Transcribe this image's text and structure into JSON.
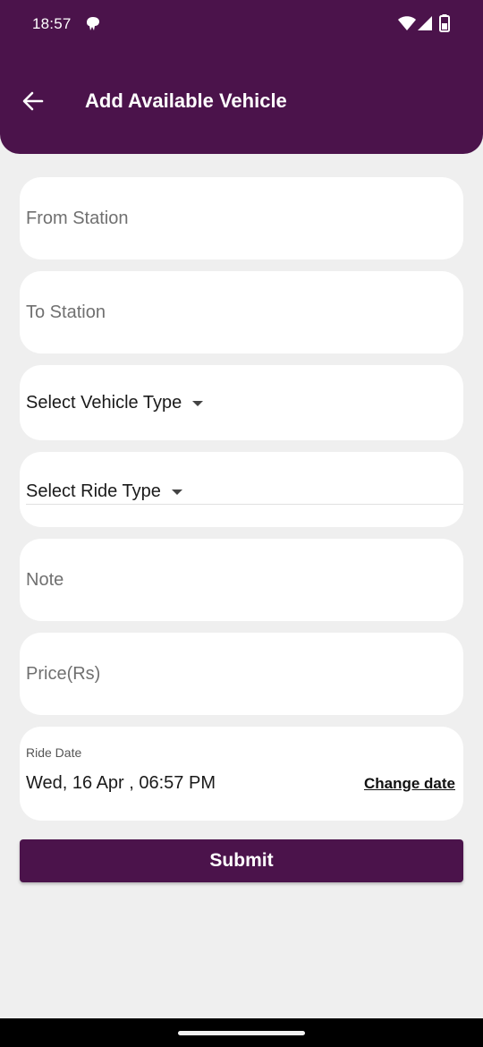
{
  "status_bar": {
    "time": "18:57"
  },
  "header": {
    "title": "Add Available Vehicle"
  },
  "form": {
    "from_station": {
      "placeholder": "From Station",
      "value": ""
    },
    "to_station": {
      "placeholder": "To Station",
      "value": ""
    },
    "vehicle_type": {
      "selected": "Select Vehicle Type"
    },
    "ride_type": {
      "selected": "Select Ride Type"
    },
    "note": {
      "placeholder": "Note",
      "value": ""
    },
    "price": {
      "placeholder": "Price(Rs)",
      "value": ""
    },
    "ride_date": {
      "label": "Ride Date",
      "value": "Wed, 16 Apr , 06:57 PM",
      "change_label": "Change date"
    },
    "submit_label": "Submit"
  },
  "icons": {
    "back": "arrow-left-icon",
    "notification": "notification-icon",
    "wifi": "wifi-icon",
    "signal": "signal-icon",
    "battery": "battery-icon",
    "dropdown": "caret-down-icon"
  },
  "colors": {
    "primary": "#4b134b",
    "background": "#efefef",
    "card": "#ffffff"
  }
}
